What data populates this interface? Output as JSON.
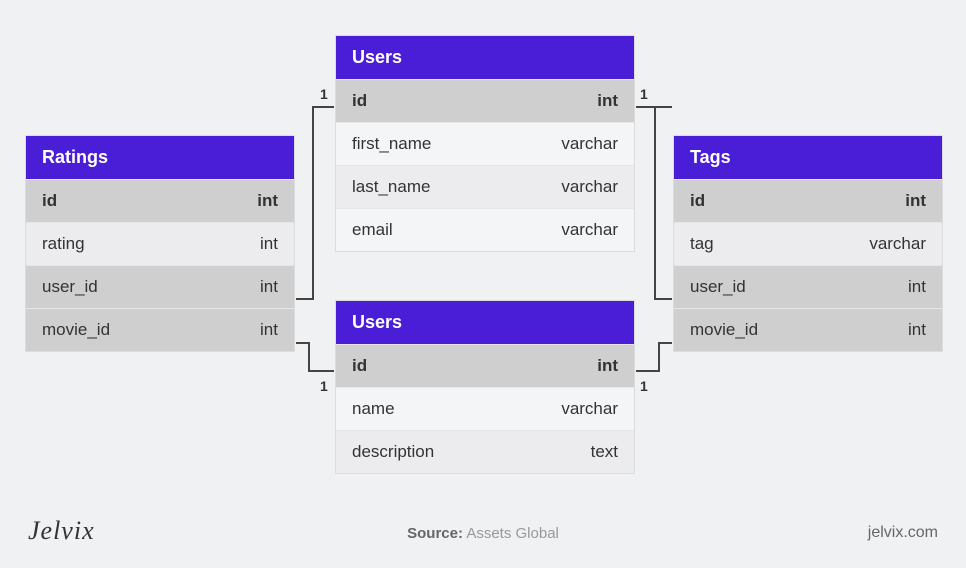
{
  "tables": {
    "ratings": {
      "title": "Ratings",
      "rows": [
        {
          "name": "id",
          "type": "int",
          "kind": "pk"
        },
        {
          "name": "rating",
          "type": "int",
          "kind": "alt"
        },
        {
          "name": "user_id",
          "type": "int",
          "kind": "fk"
        },
        {
          "name": "movie_id",
          "type": "int",
          "kind": "fk"
        }
      ]
    },
    "users1": {
      "title": "Users",
      "rows": [
        {
          "name": "id",
          "type": "int",
          "kind": "pk"
        },
        {
          "name": "first_name",
          "type": "varchar",
          "kind": "light"
        },
        {
          "name": "last_name",
          "type": "varchar",
          "kind": "alt"
        },
        {
          "name": "email",
          "type": "varchar",
          "kind": "light"
        }
      ]
    },
    "users2": {
      "title": "Users",
      "rows": [
        {
          "name": "id",
          "type": "int",
          "kind": "pk"
        },
        {
          "name": "name",
          "type": "varchar",
          "kind": "light"
        },
        {
          "name": "description",
          "type": "text",
          "kind": "alt"
        }
      ]
    },
    "tags": {
      "title": "Tags",
      "rows": [
        {
          "name": "id",
          "type": "int",
          "kind": "pk"
        },
        {
          "name": "tag",
          "type": "varchar",
          "kind": "alt"
        },
        {
          "name": "user_id",
          "type": "int",
          "kind": "fk"
        },
        {
          "name": "movie_id",
          "type": "int",
          "kind": "fk"
        }
      ]
    }
  },
  "cardinality": {
    "one": "1"
  },
  "footer": {
    "brand": "Jelvix",
    "source_label": "Source:",
    "source_value": "Assets Global",
    "site": "jelvix.com"
  },
  "chart_data": {
    "type": "table",
    "description": "Entity-relationship diagram with four tables and four 1-to-1 connectors",
    "entities": [
      {
        "name": "Ratings",
        "columns": [
          {
            "name": "id",
            "type": "int",
            "pk": true
          },
          {
            "name": "rating",
            "type": "int"
          },
          {
            "name": "user_id",
            "type": "int",
            "fk": true
          },
          {
            "name": "movie_id",
            "type": "int",
            "fk": true
          }
        ]
      },
      {
        "name": "Users",
        "columns": [
          {
            "name": "id",
            "type": "int",
            "pk": true
          },
          {
            "name": "first_name",
            "type": "varchar"
          },
          {
            "name": "last_name",
            "type": "varchar"
          },
          {
            "name": "email",
            "type": "varchar"
          }
        ]
      },
      {
        "name": "Users",
        "columns": [
          {
            "name": "id",
            "type": "int",
            "pk": true
          },
          {
            "name": "name",
            "type": "varchar"
          },
          {
            "name": "description",
            "type": "text"
          }
        ]
      },
      {
        "name": "Tags",
        "columns": [
          {
            "name": "id",
            "type": "int",
            "pk": true
          },
          {
            "name": "tag",
            "type": "varchar"
          },
          {
            "name": "user_id",
            "type": "int",
            "fk": true
          },
          {
            "name": "movie_id",
            "type": "int",
            "fk": true
          }
        ]
      }
    ],
    "relationships": [
      {
        "from": "Ratings.user_id",
        "to": "Users.id",
        "cardinality": "1"
      },
      {
        "from": "Ratings.movie_id",
        "to": "Users.id",
        "cardinality": "1"
      },
      {
        "from": "Tags.user_id",
        "to": "Users.id",
        "cardinality": "1"
      },
      {
        "from": "Tags.movie_id",
        "to": "Users.id",
        "cardinality": "1"
      }
    ]
  }
}
